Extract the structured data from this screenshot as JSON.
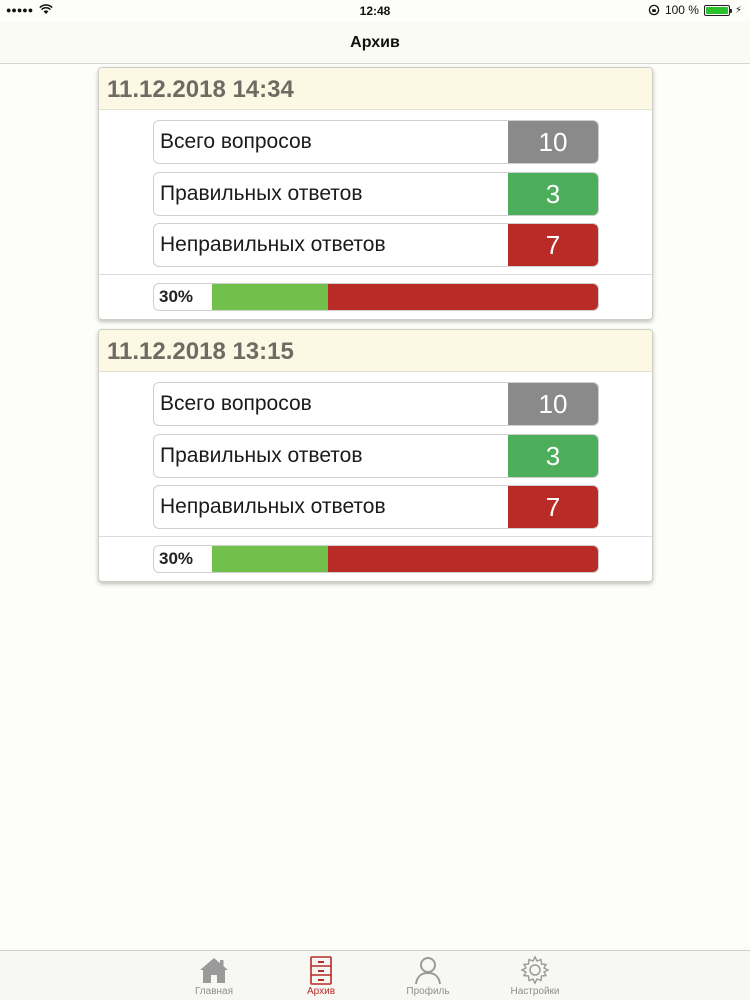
{
  "status_bar": {
    "time": "12:48",
    "signal": "●●●●●",
    "battery_text": "100 %"
  },
  "nav": {
    "title": "Архив"
  },
  "cards": [
    {
      "date": "11.12.2018 14:34",
      "rows": [
        {
          "label": "Всего вопросов",
          "value": "10"
        },
        {
          "label": "Правильных ответов",
          "value": "3"
        },
        {
          "label": "Неправильных ответов",
          "value": "7"
        }
      ],
      "progress_label": "30%",
      "progress_fraction": 0.3
    },
    {
      "date": "11.12.2018 13:15",
      "rows": [
        {
          "label": "Всего вопросов",
          "value": "10"
        },
        {
          "label": "Правильных ответов",
          "value": "3"
        },
        {
          "label": "Неправильных ответов",
          "value": "7"
        }
      ],
      "progress_label": "30%",
      "progress_fraction": 0.3
    }
  ],
  "tabs": [
    {
      "label": "Главная",
      "icon": "home-icon"
    },
    {
      "label": "Архив",
      "icon": "archive-icon",
      "active": true
    },
    {
      "label": "Профиль",
      "icon": "profile-icon"
    },
    {
      "label": "Настройки",
      "icon": "settings-icon"
    }
  ],
  "colors": {
    "accent": "#b82b27",
    "correct": "#4cae5a",
    "neutral": "#8a8a8a",
    "progress_correct": "#72c04c",
    "header_bg": "#fdf8e4"
  }
}
